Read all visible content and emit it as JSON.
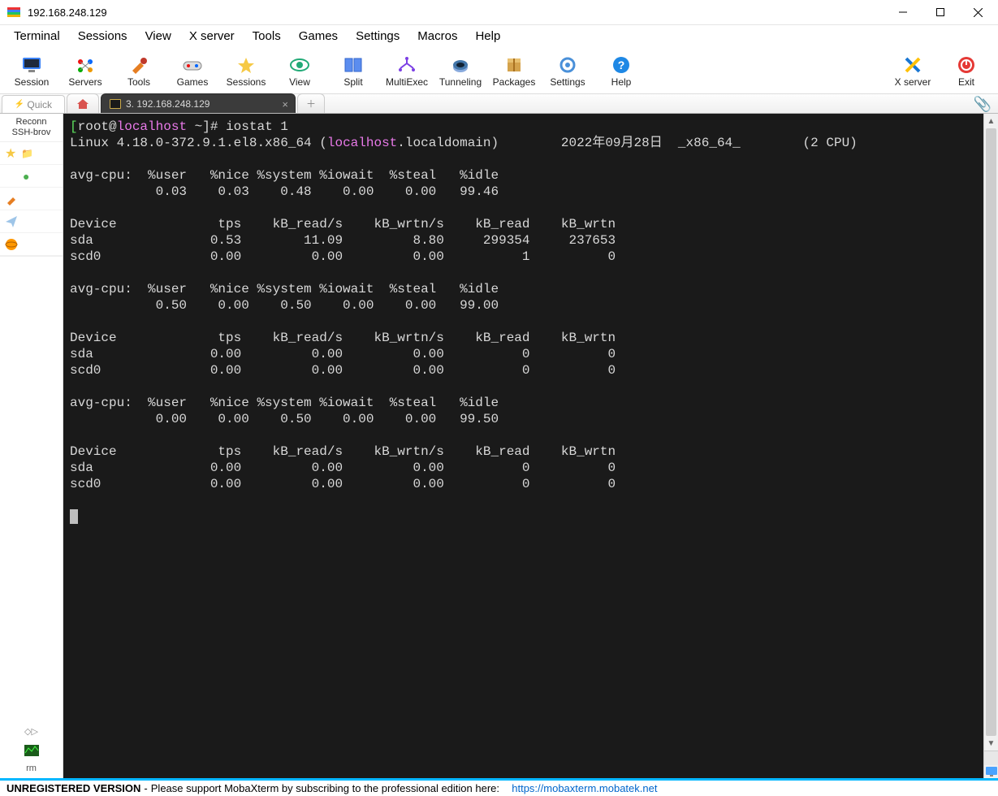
{
  "window": {
    "title": "192.168.248.129"
  },
  "menu": [
    "Terminal",
    "Sessions",
    "View",
    "X server",
    "Tools",
    "Games",
    "Settings",
    "Macros",
    "Help"
  ],
  "toolbar": [
    {
      "id": "session",
      "label": "Session"
    },
    {
      "id": "servers",
      "label": "Servers"
    },
    {
      "id": "tools",
      "label": "Tools"
    },
    {
      "id": "games",
      "label": "Games"
    },
    {
      "id": "sessions",
      "label": "Sessions"
    },
    {
      "id": "view",
      "label": "View"
    },
    {
      "id": "split",
      "label": "Split"
    },
    {
      "id": "multiexec",
      "label": "MultiExec"
    },
    {
      "id": "tunneling",
      "label": "Tunneling"
    },
    {
      "id": "packages",
      "label": "Packages"
    },
    {
      "id": "settings",
      "label": "Settings"
    },
    {
      "id": "help",
      "label": "Help"
    }
  ],
  "toolbar_right": [
    {
      "id": "xserver",
      "label": "X server"
    },
    {
      "id": "exit",
      "label": "Exit"
    }
  ],
  "tabs": {
    "quick": "Quick",
    "session_label": "3. 192.168.248.129"
  },
  "sidebar": {
    "line1": "Reconn",
    "line2": "SSH-brov",
    "rm": "rm"
  },
  "terminal": {
    "prompt_user": "root",
    "prompt_at": "@",
    "prompt_host": "localhost",
    "prompt_tail": " ~]# ",
    "command": "iostat 1",
    "line2_a": "Linux 4.18.0-372.9.1.el8.x86_64 (",
    "line2_host": "localhost",
    "line2_b": ".localdomain)        2022年09月28日  _x86_64_        (2 CPU)",
    "blank": "",
    "cpu_hdr": "avg-cpu:  %user   %nice %system %iowait  %steal   %idle",
    "cpu1": "           0.03    0.03    0.48    0.00    0.00   99.46",
    "dev_hdr": "Device             tps    kB_read/s    kB_wrtn/s    kB_read    kB_wrtn",
    "dev1a": "sda               0.53        11.09         8.80     299354     237653",
    "dev1b": "scd0              0.00         0.00         0.00          1          0",
    "cpu2": "           0.50    0.00    0.50    0.00    0.00   99.00",
    "dev2a": "sda               0.00         0.00         0.00          0          0",
    "dev2b": "scd0              0.00         0.00         0.00          0          0",
    "cpu3": "           0.00    0.00    0.50    0.00    0.00   99.50",
    "dev3a": "sda               0.00         0.00         0.00          0          0",
    "dev3b": "scd0              0.00         0.00         0.00          0          0"
  },
  "status": {
    "unreg": "UNREGISTERED VERSION",
    "dash": "  -  ",
    "msg": "Please support MobaXterm by subscribing to the professional edition here:",
    "url": "https://mobaxterm.mobatek.net"
  }
}
